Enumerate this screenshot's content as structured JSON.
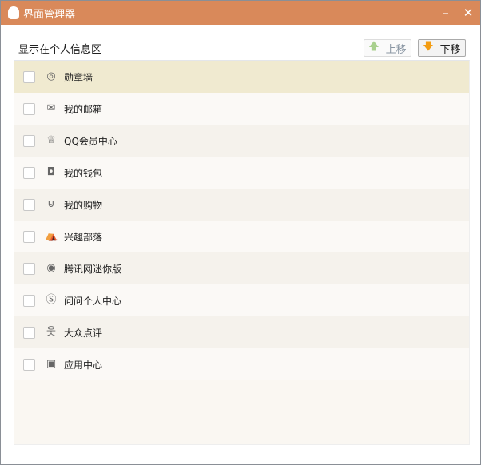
{
  "window": {
    "title": "界面管理器",
    "minimize": "–",
    "close": "✕"
  },
  "header": {
    "label": "显示在个人信息区"
  },
  "buttons": {
    "up": "上移",
    "up_arrow": "🡅",
    "down": "下移",
    "down_arrow": "🡇"
  },
  "colors": {
    "titlebar": "#d9895a",
    "selected_row": "#f0ead0"
  },
  "items": [
    {
      "label": "勋章墙",
      "icon": "◎",
      "checked": false,
      "selected": true
    },
    {
      "label": "我的邮箱",
      "icon": "✉",
      "checked": false
    },
    {
      "label": "QQ会员中心",
      "icon": "♕",
      "checked": false
    },
    {
      "label": "我的钱包",
      "icon": "◘",
      "checked": false
    },
    {
      "label": "我的购物",
      "icon": "⊍",
      "checked": false
    },
    {
      "label": "兴趣部落",
      "icon": "⛺",
      "checked": false
    },
    {
      "label": "腾讯网迷你版",
      "icon": "◉",
      "checked": false
    },
    {
      "label": "问问个人中心",
      "icon": "Ⓢ",
      "checked": false
    },
    {
      "label": "大众点评",
      "icon": "웃",
      "checked": false
    },
    {
      "label": "应用中心",
      "icon": "▣",
      "checked": false
    }
  ]
}
